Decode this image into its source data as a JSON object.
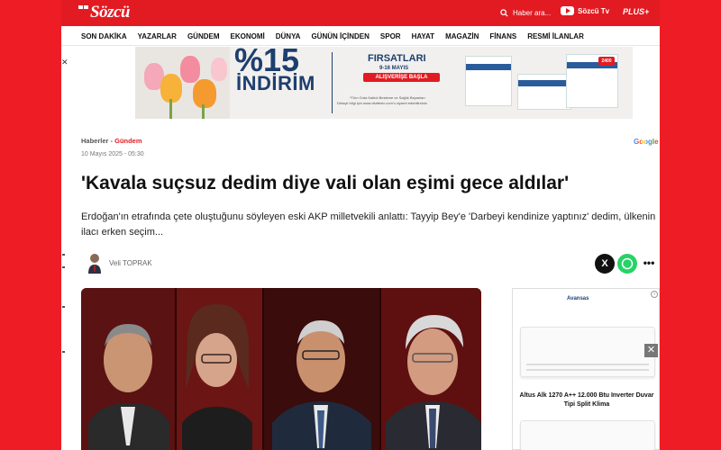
{
  "header": {
    "logo_text": "Sözcü",
    "search_placeholder": "Haber ara...",
    "tv_label": "Sözcü Tv",
    "plus_label": "PLUS+"
  },
  "nav": {
    "items": [
      "SON DAKİKA",
      "YAZARLAR",
      "GÜNDEM",
      "EKONOMİ",
      "DÜNYA",
      "GÜNÜN İÇİNDEN",
      "SPOR",
      "HAYAT",
      "MAGAZİN",
      "FİNANS",
      "RESMİ İLANLAR"
    ]
  },
  "ad_banner": {
    "percent_text": "%15",
    "discount_label": "İNDİRİM",
    "headline": "FIRSATLARI",
    "dates": "9-16 MAYIS",
    "cta": "ALIŞVERİŞE BAŞLA",
    "fine_print": "*Tüm Gıda Katkılı Besleme ve Sağlık Beyanları",
    "fine_print_2": "Detaylı bilgi için www.vitafenix.com'u ziyaret edebilirsiniz.",
    "product_badge": "2400"
  },
  "article": {
    "breadcrumb_parent": "Haberler",
    "breadcrumb_separator": " - ",
    "breadcrumb_current": "Gündem",
    "date": "10 Mayıs 2025 - 05:30",
    "headline": "'Kavala suçsuz dedim diye vali olan eşimi gece aldılar'",
    "summary": "Erdoğan'ın etrafında çete oluştuğunu söyleyen eski AKP milletvekili anlattı: Tayyip Bey'e 'Darbeyi kendinize yaptınız' dedim, ülkenin ilacı erken seçim...",
    "author": "Veli TOPRAK",
    "google_tag": "Google"
  },
  "share": {
    "x_label": "X",
    "more_label": "•••"
  },
  "side_ad": {
    "brand": "Avansas",
    "info_label": "i",
    "product": "Altus Alk 1270 A++ 12.000 Btu Inverter Duvar Tipi Split Klima",
    "close_label": "✕"
  },
  "left_strip": {
    "close_label": "✕"
  },
  "colors": {
    "brand_red": "#e21b22",
    "page_red": "#ee1c25",
    "ad_navy": "#1d3f6e",
    "whatsapp_green": "#25d366"
  }
}
